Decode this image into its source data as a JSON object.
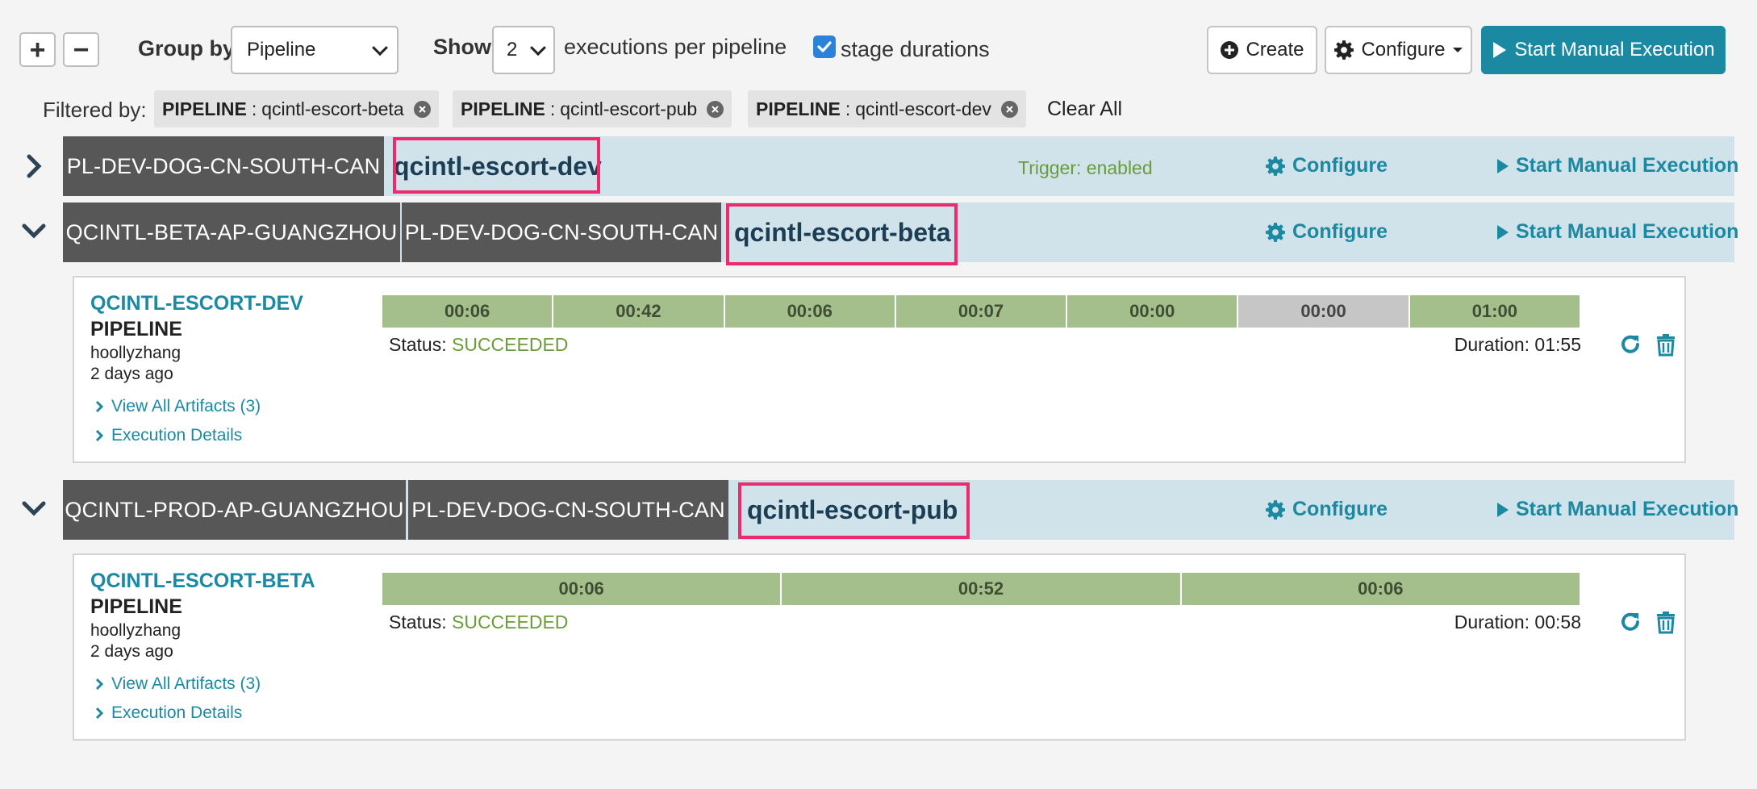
{
  "toolbar": {
    "expand_all": "+",
    "collapse_all": "−",
    "group_by_label": "Group by",
    "group_by_value": "Pipeline",
    "show_label": "Show",
    "show_value": "2",
    "executions_label": "executions per pipeline",
    "stage_durations_label": "stage durations",
    "stage_durations_checked": true,
    "create_label": "Create",
    "configure_label": "Configure",
    "start_manual_label": "Start Manual Execution"
  },
  "filters": {
    "label": "Filtered by:",
    "chips": [
      {
        "key": "PIPELINE",
        "value": "qcintl-escort-beta"
      },
      {
        "key": "PIPELINE",
        "value": "qcintl-escort-pub"
      },
      {
        "key": "PIPELINE",
        "value": "qcintl-escort-dev"
      }
    ],
    "clear_all": "Clear All"
  },
  "groups": [
    {
      "expanded": false,
      "tags": [
        "PL-DEV-DOG-CN-SOUTH-CAN"
      ],
      "name": "qcintl-escort-dev",
      "trigger": "Trigger: enabled",
      "configure": "Configure",
      "start": "Start Manual Execution"
    },
    {
      "expanded": true,
      "tags": [
        "QCINTL-BETA-AP-GUANGZHOU",
        "PL-DEV-DOG-CN-SOUTH-CAN"
      ],
      "name": "qcintl-escort-beta",
      "configure": "Configure",
      "start": "Start Manual Execution",
      "execution": {
        "title": "QCINTL-ESCORT-DEV",
        "subtitle": "PIPELINE",
        "user": "hoollyzhang",
        "time": "2 days ago",
        "artifacts": "View All Artifacts (3)",
        "details": "Execution Details",
        "stages": [
          "00:06",
          "00:42",
          "00:06",
          "00:07",
          "00:00",
          "00:00",
          "01:00"
        ],
        "status_label": "Status:",
        "status": "SUCCEEDED",
        "duration": "Duration: 01:55"
      }
    },
    {
      "expanded": true,
      "tags": [
        "QCINTL-PROD-AP-GUANGZHOU",
        "PL-DEV-DOG-CN-SOUTH-CAN"
      ],
      "name": "qcintl-escort-pub",
      "configure": "Configure",
      "start": "Start Manual Execution",
      "execution": {
        "title": "QCINTL-ESCORT-BETA",
        "subtitle": "PIPELINE",
        "user": "hoollyzhang",
        "time": "2 days ago",
        "artifacts": "View All Artifacts (3)",
        "details": "Execution Details",
        "stages": [
          "00:06",
          "00:52",
          "00:06"
        ],
        "status_label": "Status:",
        "status": "SUCCEEDED",
        "duration": "Duration: 00:58"
      }
    }
  ],
  "colors": {
    "accent": "#1c89a3",
    "highlight": "#ec2a6c",
    "success": "#6a9c3a",
    "stage": "#a4bf8c",
    "header_bg": "#d0e3ea",
    "tag_bg": "#575757"
  }
}
